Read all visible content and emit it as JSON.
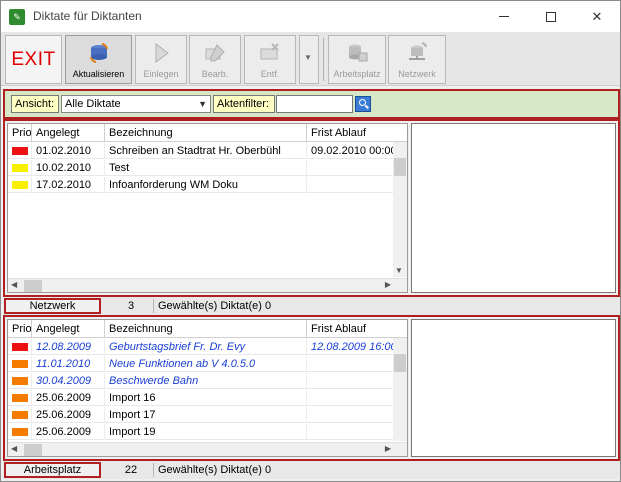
{
  "window": {
    "title": "Diktate für Diktanten"
  },
  "toolbar": {
    "exit_label": "EXIT",
    "refresh_label": "Aktualisieren",
    "einlegen_label": "Einlegen",
    "bearb_label": "Bearb.",
    "entf_label": "Entf.",
    "arbeitsplatz_label": "Arbeitsplatz",
    "netzwerk_label": "Netzwerk"
  },
  "filter": {
    "ansicht_label": "Ansicht:",
    "ansicht_value": "Alle Diktate",
    "aktenfilter_label": "Aktenfilter:",
    "aktenfilter_value": ""
  },
  "columns": {
    "prio": "Prio",
    "angelegt": "Angelegt",
    "bezeichnung": "Bezeichnung",
    "frist": "Frist Ablauf"
  },
  "network_panel": {
    "rows": [
      {
        "prio_color": "#ee1111",
        "angelegt": "01.02.2010",
        "bezeichnung": "Schreiben an Stadtrat Hr. Oberbühl",
        "frist": "09.02.2010 00:00"
      },
      {
        "prio_color": "#f8f000",
        "angelegt": "10.02.2010",
        "bezeichnung": "Test",
        "frist": ""
      },
      {
        "prio_color": "#f8f000",
        "angelegt": "17.02.2010",
        "bezeichnung": "Infoanforderung WM Doku",
        "frist": ""
      }
    ],
    "status_label": "Netzwerk",
    "count": "3",
    "selected_text": "Gewählte(s) Diktat(e) 0"
  },
  "workplace_panel": {
    "rows": [
      {
        "prio_color": "#ee1111",
        "angelegt": "12.08.2009",
        "bezeichnung": "Geburtstagsbrief Fr. Dr. Evy",
        "frist": "12.08.2009 16:00",
        "style": "italic"
      },
      {
        "prio_color": "#f57c00",
        "angelegt": "11.01.2010",
        "bezeichnung": "Neue Funktionen ab V 4.0.5.0",
        "frist": "",
        "style": "italic"
      },
      {
        "prio_color": "#f57c00",
        "angelegt": "30.04.2009",
        "bezeichnung": "Beschwerde Bahn",
        "frist": "",
        "style": "italic"
      },
      {
        "prio_color": "#f57c00",
        "angelegt": "25.06.2009",
        "bezeichnung": "Import 16",
        "frist": "",
        "style": "normal"
      },
      {
        "prio_color": "#f57c00",
        "angelegt": "25.06.2009",
        "bezeichnung": "Import 17",
        "frist": "",
        "style": "normal"
      },
      {
        "prio_color": "#f57c00",
        "angelegt": "25.06.2009",
        "bezeichnung": "Import 19",
        "frist": "",
        "style": "normal"
      }
    ],
    "status_label": "Arbeitsplatz",
    "count": "22",
    "selected_text": "Gewählte(s) Diktat(e) 0"
  },
  "colors": {
    "accent_red": "#b02020",
    "filter_bg": "#d6e8c8",
    "italic_text": "#1a3fd6"
  }
}
